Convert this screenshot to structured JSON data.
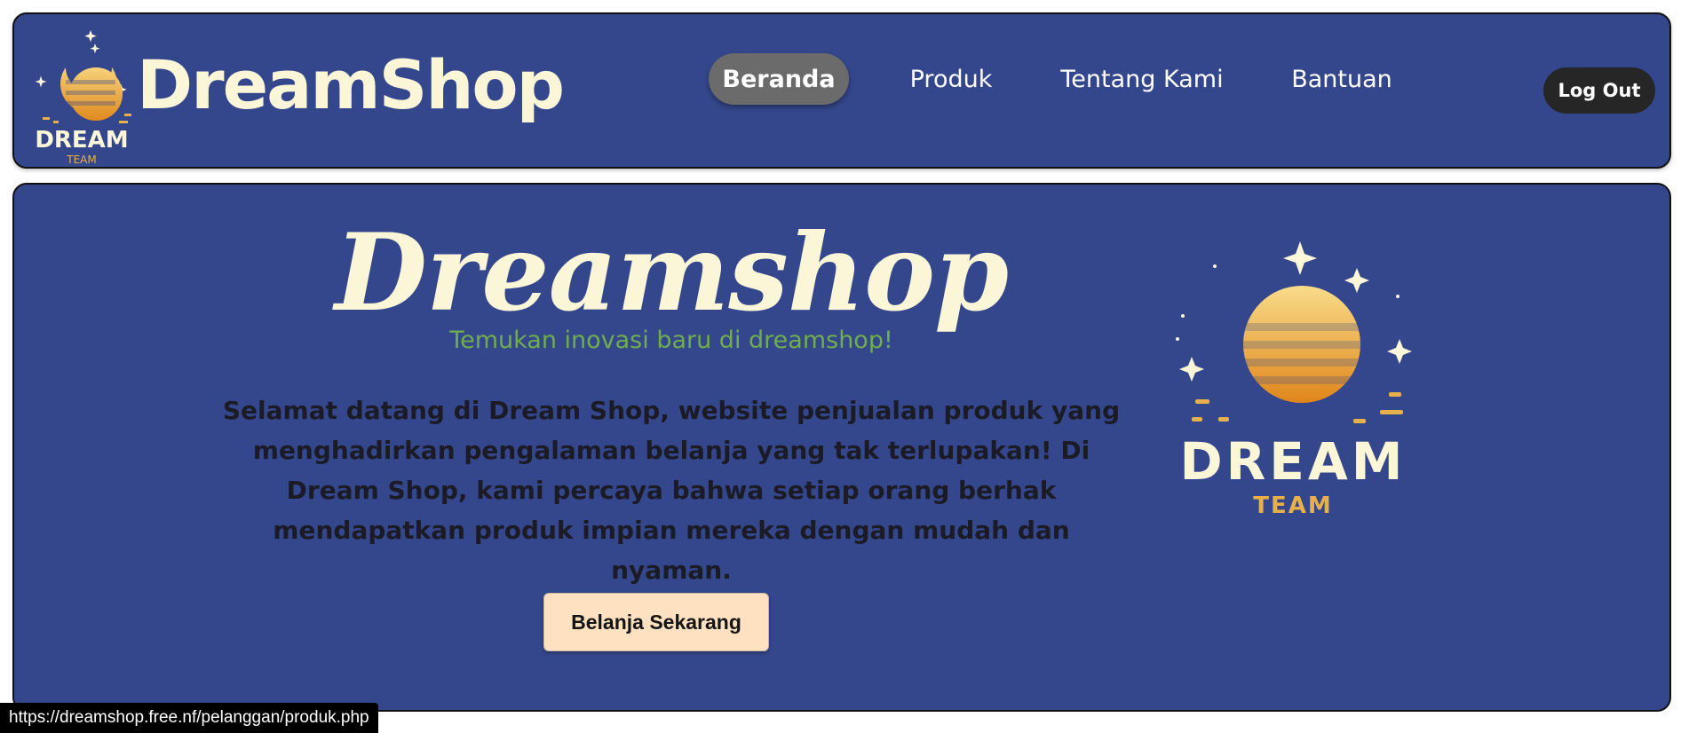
{
  "header": {
    "brand_name": "DreamShop",
    "logo_word": "DREAM",
    "logo_sub": "TEAM",
    "nav": [
      {
        "label": "Beranda",
        "active": true
      },
      {
        "label": "Produk",
        "active": false
      },
      {
        "label": "Tentang Kami",
        "active": false
      },
      {
        "label": "Bantuan",
        "active": false
      }
    ],
    "logout_label": "Log Out"
  },
  "hero": {
    "title": "Dreamshop",
    "subtitle": "Temukan inovasi baru di dreamshop!",
    "paragraph": "Selamat datang di Dream Shop, website penjualan produk yang menghadirkan pengalaman belanja yang tak terlupakan! Di Dream Shop, kami percaya bahwa setiap orang berhak mendapatkan produk impian mereka dengan mudah dan nyaman.",
    "cta_label": "Belanja Sekarang",
    "logo_word": "DREAM",
    "logo_sub": "TEAM"
  },
  "status_bar": {
    "url": "https://dreamshop.free.nf/pelanggan/produk.php"
  },
  "colors": {
    "panel_bg": "#34478c",
    "cream": "#fbf6d7",
    "gold": "#e8b04a",
    "subtitle_green": "#6fae4e",
    "cta_bg": "#fde1c0",
    "active_nav_bg": "#6b6b6b",
    "logout_bg": "#262626"
  }
}
